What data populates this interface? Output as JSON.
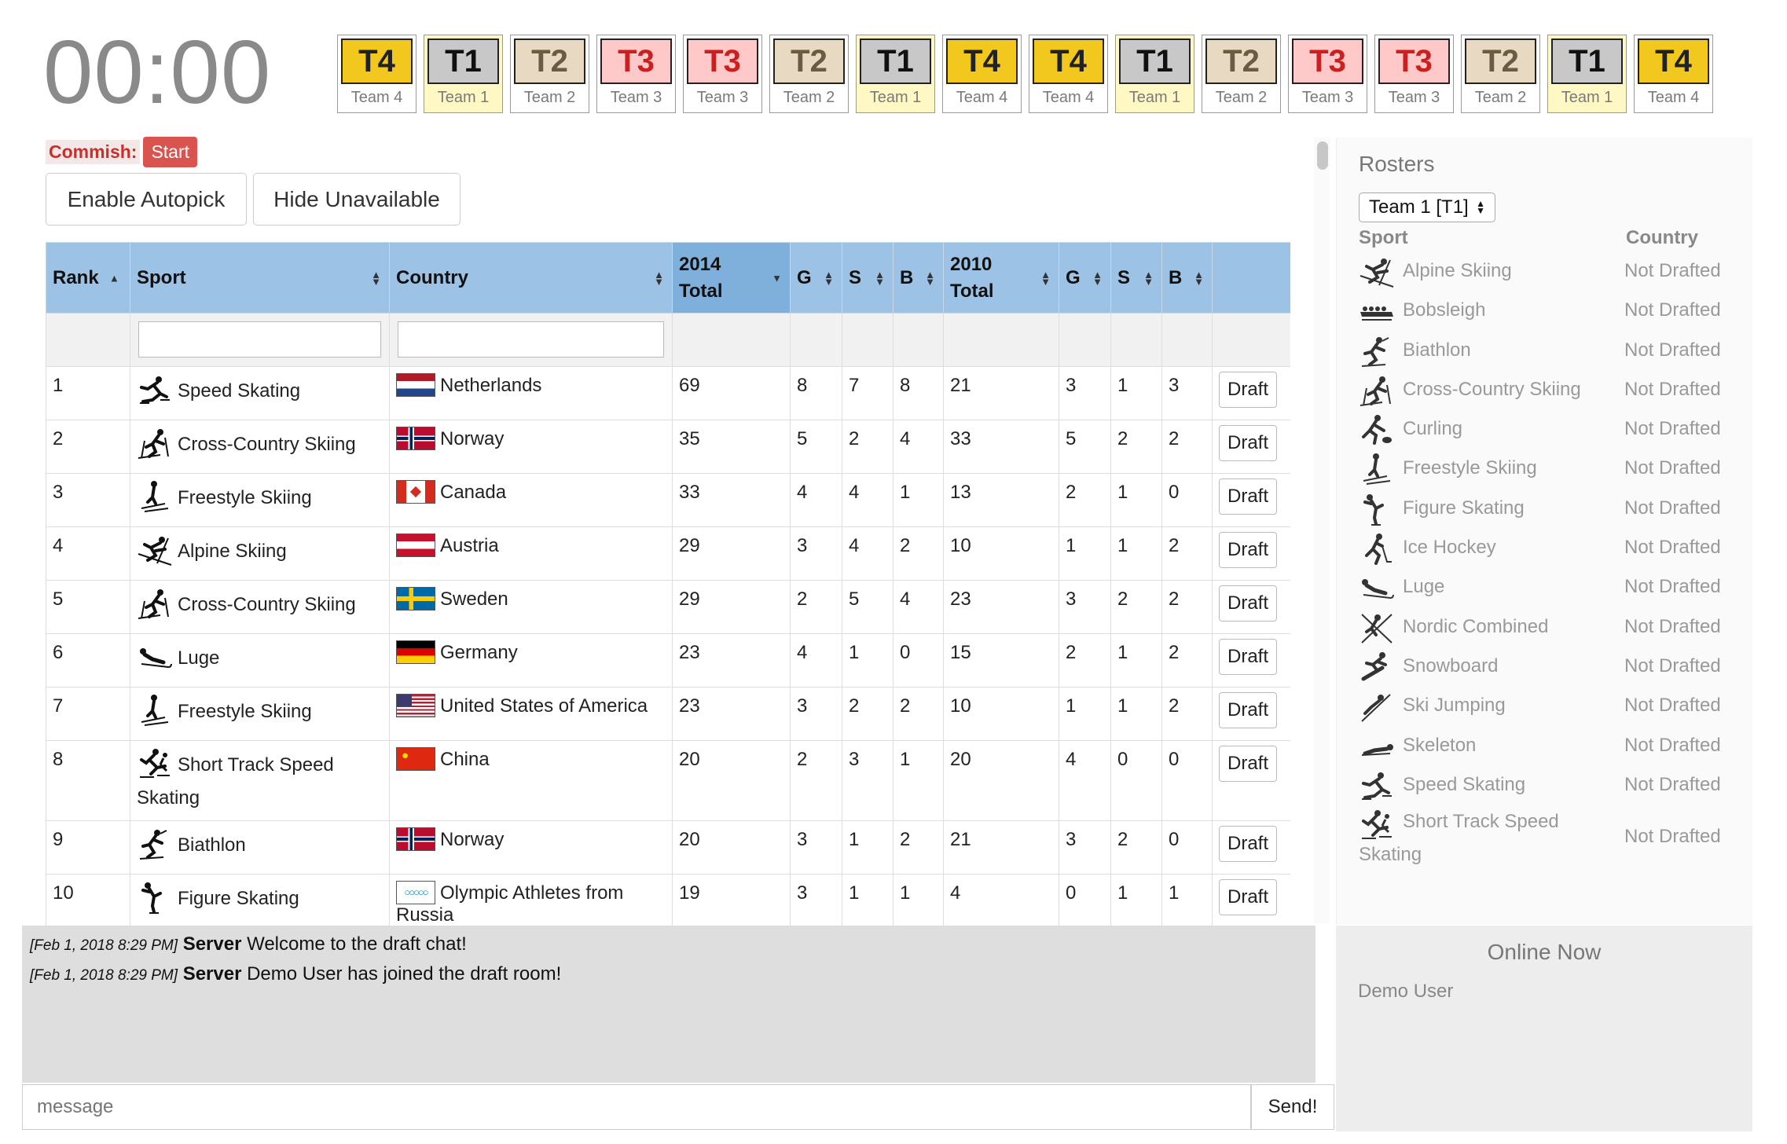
{
  "timer": "00:00",
  "draft_order": [
    {
      "code": "T4",
      "team": "Team 4",
      "fill": "#f2c81f",
      "text": "#222"
    },
    {
      "code": "T1",
      "team": "Team 1",
      "fill": "#c8c8c8",
      "text": "#111",
      "current": true
    },
    {
      "code": "T2",
      "team": "Team 2",
      "fill": "#e8d9c3",
      "text": "#6b5a44"
    },
    {
      "code": "T3",
      "team": "Team 3",
      "fill": "#ffc9c9",
      "text": "#cc1f1f"
    },
    {
      "code": "T3",
      "team": "Team 3",
      "fill": "#ffc9c9",
      "text": "#cc1f1f"
    },
    {
      "code": "T2",
      "team": "Team 2",
      "fill": "#e8d9c3",
      "text": "#6b5a44"
    },
    {
      "code": "T1",
      "team": "Team 1",
      "fill": "#c8c8c8",
      "text": "#111",
      "current": true
    },
    {
      "code": "T4",
      "team": "Team 4",
      "fill": "#f2c81f",
      "text": "#222"
    },
    {
      "code": "T4",
      "team": "Team 4",
      "fill": "#f2c81f",
      "text": "#222"
    },
    {
      "code": "T1",
      "team": "Team 1",
      "fill": "#c8c8c8",
      "text": "#111",
      "current": true
    },
    {
      "code": "T2",
      "team": "Team 2",
      "fill": "#e8d9c3",
      "text": "#6b5a44"
    },
    {
      "code": "T3",
      "team": "Team 3",
      "fill": "#ffc9c9",
      "text": "#cc1f1f"
    },
    {
      "code": "T3",
      "team": "Team 3",
      "fill": "#ffc9c9",
      "text": "#cc1f1f"
    },
    {
      "code": "T2",
      "team": "Team 2",
      "fill": "#e8d9c3",
      "text": "#6b5a44"
    },
    {
      "code": "T1",
      "team": "Team 1",
      "fill": "#c8c8c8",
      "text": "#111",
      "current": true
    },
    {
      "code": "T4",
      "team": "Team 4",
      "fill": "#f2c81f",
      "text": "#222"
    }
  ],
  "commish": {
    "label": "Commish:",
    "start_label": "Start"
  },
  "buttons": {
    "autopick": "Enable Autopick",
    "hide_unavailable": "Hide Unavailable"
  },
  "table": {
    "headers": {
      "rank": "Rank",
      "sport": "Sport",
      "country": "Country",
      "total2014_a": "2014",
      "total2014_b": "Total",
      "g": "G",
      "s": "S",
      "b": "B",
      "total2010_a": "2010",
      "total2010_b": "Total"
    },
    "draft_label": "Draft",
    "rows": [
      {
        "rank": "1",
        "sport": "Speed Skating",
        "sport_icon": "speed-skating-icon",
        "country": "Netherlands",
        "flag": "netherlands",
        "t14": "69",
        "g14": "8",
        "s14": "7",
        "b14": "8",
        "t10": "21",
        "g10": "3",
        "s10": "1",
        "b10": "3"
      },
      {
        "rank": "2",
        "sport": "Cross-Country Skiing",
        "sport_icon": "cross-country-skiing-icon",
        "country": "Norway",
        "flag": "norway",
        "t14": "35",
        "g14": "5",
        "s14": "2",
        "b14": "4",
        "t10": "33",
        "g10": "5",
        "s10": "2",
        "b10": "2"
      },
      {
        "rank": "3",
        "sport": "Freestyle Skiing",
        "sport_icon": "freestyle-skiing-icon",
        "country": "Canada",
        "flag": "canada",
        "t14": "33",
        "g14": "4",
        "s14": "4",
        "b14": "1",
        "t10": "13",
        "g10": "2",
        "s10": "1",
        "b10": "0"
      },
      {
        "rank": "4",
        "sport": "Alpine Skiing",
        "sport_icon": "alpine-skiing-icon",
        "country": "Austria",
        "flag": "austria",
        "t14": "29",
        "g14": "3",
        "s14": "4",
        "b14": "2",
        "t10": "10",
        "g10": "1",
        "s10": "1",
        "b10": "2"
      },
      {
        "rank": "5",
        "sport": "Cross-Country Skiing",
        "sport_icon": "cross-country-skiing-icon",
        "country": "Sweden",
        "flag": "sweden",
        "t14": "29",
        "g14": "2",
        "s14": "5",
        "b14": "4",
        "t10": "23",
        "g10": "3",
        "s10": "2",
        "b10": "2"
      },
      {
        "rank": "6",
        "sport": "Luge",
        "sport_icon": "luge-icon",
        "country": "Germany",
        "flag": "germany",
        "t14": "23",
        "g14": "4",
        "s14": "1",
        "b14": "0",
        "t10": "15",
        "g10": "2",
        "s10": "1",
        "b10": "2"
      },
      {
        "rank": "7",
        "sport": "Freestyle Skiing",
        "sport_icon": "freestyle-skiing-icon",
        "country": "United States of America",
        "flag": "usa",
        "t14": "23",
        "g14": "3",
        "s14": "2",
        "b14": "2",
        "t10": "10",
        "g10": "1",
        "s10": "1",
        "b10": "2"
      },
      {
        "rank": "8",
        "sport": "Short Track Speed Skating",
        "sport_icon": "short-track-icon",
        "country": "China",
        "flag": "china",
        "t14": "20",
        "g14": "2",
        "s14": "3",
        "b14": "1",
        "t10": "20",
        "g10": "4",
        "s10": "0",
        "b10": "0",
        "tall": true
      },
      {
        "rank": "9",
        "sport": "Biathlon",
        "sport_icon": "biathlon-icon",
        "country": "Norway",
        "flag": "norway",
        "t14": "20",
        "g14": "3",
        "s14": "1",
        "b14": "2",
        "t10": "21",
        "g10": "3",
        "s10": "2",
        "b10": "0"
      },
      {
        "rank": "10",
        "sport": "Figure Skating",
        "sport_icon": "figure-skating-icon",
        "country": "Olympic Athletes from Russia",
        "flag": "olympic",
        "t14": "19",
        "g14": "3",
        "s14": "1",
        "b14": "1",
        "t10": "4",
        "g10": "0",
        "s10": "1",
        "b10": "1",
        "tall": true
      }
    ]
  },
  "chat": {
    "messages": [
      {
        "ts": "[Feb 1, 2018 8:29 PM]",
        "who": "Server",
        "text": "Welcome to the draft chat!"
      },
      {
        "ts": "[Feb 1, 2018 8:29 PM]",
        "who": "Server",
        "text": "Demo User has joined the draft room!"
      }
    ],
    "placeholder": "message",
    "send_label": "Send!"
  },
  "sidebar": {
    "title": "Rosters",
    "team_select": "Team 1 [T1]",
    "col_sport": "Sport",
    "col_country": "Country",
    "roster": [
      {
        "sport": "Alpine Skiing",
        "icon": "alpine-skiing-icon",
        "status": "Not Drafted"
      },
      {
        "sport": "Bobsleigh",
        "icon": "bobsleigh-icon",
        "status": "Not Drafted"
      },
      {
        "sport": "Biathlon",
        "icon": "biathlon-icon",
        "status": "Not Drafted"
      },
      {
        "sport": "Cross-Country Skiing",
        "icon": "cross-country-skiing-icon",
        "status": "Not Drafted"
      },
      {
        "sport": "Curling",
        "icon": "curling-icon",
        "status": "Not Drafted"
      },
      {
        "sport": "Freestyle Skiing",
        "icon": "freestyle-skiing-icon",
        "status": "Not Drafted"
      },
      {
        "sport": "Figure Skating",
        "icon": "figure-skating-icon",
        "status": "Not Drafted"
      },
      {
        "sport": "Ice Hockey",
        "icon": "ice-hockey-icon",
        "status": "Not Drafted"
      },
      {
        "sport": "Luge",
        "icon": "luge-icon",
        "status": "Not Drafted"
      },
      {
        "sport": "Nordic Combined",
        "icon": "nordic-combined-icon",
        "status": "Not Drafted"
      },
      {
        "sport": "Snowboard",
        "icon": "snowboard-icon",
        "status": "Not Drafted"
      },
      {
        "sport": "Ski Jumping",
        "icon": "ski-jumping-icon",
        "status": "Not Drafted"
      },
      {
        "sport": "Skeleton",
        "icon": "skeleton-icon",
        "status": "Not Drafted"
      },
      {
        "sport": "Speed Skating",
        "icon": "speed-skating-icon",
        "status": "Not Drafted"
      },
      {
        "sport": "Short Track Speed Skating",
        "icon": "short-track-icon",
        "status": "Not Drafted"
      }
    ]
  },
  "online": {
    "title": "Online Now",
    "users": [
      "Demo User"
    ]
  }
}
